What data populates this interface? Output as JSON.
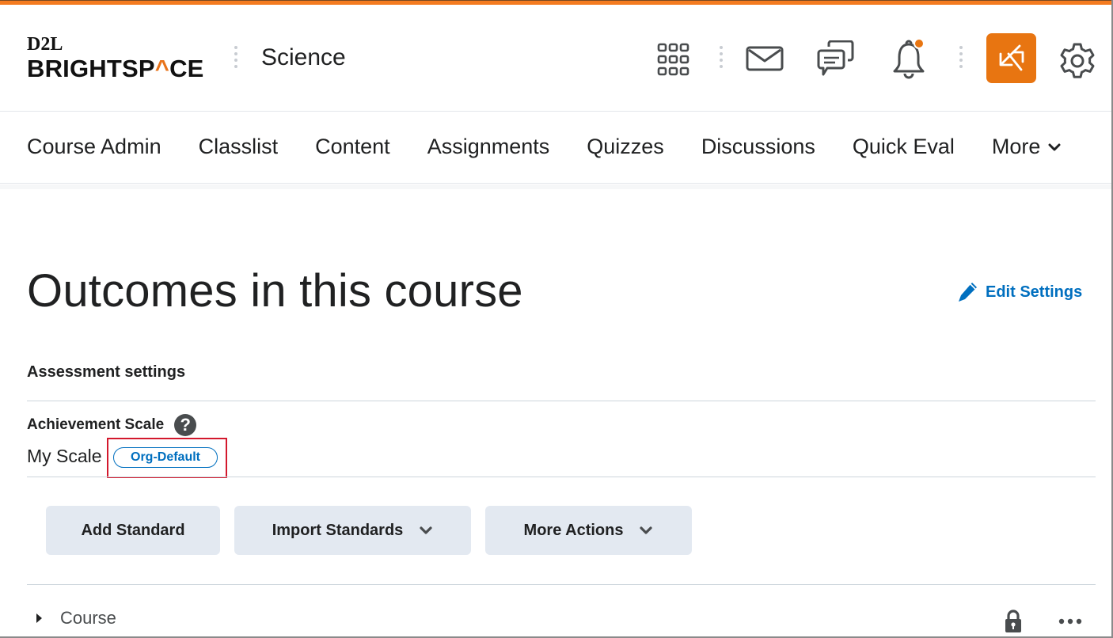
{
  "header": {
    "logo_top": "D2L",
    "logo_bottom_pre": "BRIGHTSP",
    "logo_bottom_accent": "^",
    "logo_bottom_post": "CE",
    "course_name": "Science",
    "icons": [
      "waffle-grid-icon",
      "mail-icon",
      "chat-icon",
      "bell-icon",
      "role-switch-icon",
      "gear-icon"
    ],
    "notification_badge_color": "#e87511"
  },
  "nav": {
    "items": [
      {
        "label": "Course Admin"
      },
      {
        "label": "Classlist"
      },
      {
        "label": "Content"
      },
      {
        "label": "Assignments"
      },
      {
        "label": "Quizzes"
      },
      {
        "label": "Discussions"
      },
      {
        "label": "Quick Eval"
      },
      {
        "label": "More"
      }
    ]
  },
  "main": {
    "title": "Outcomes in this course",
    "edit_settings_label": "Edit Settings",
    "assessment_settings_heading": "Assessment settings",
    "achievement_scale_label": "Achievement Scale",
    "help_glyph": "?",
    "scale_value": "My Scale",
    "scale_badge": "Org-Default",
    "actions": {
      "add_standard": "Add Standard",
      "import_standards": "Import Standards",
      "more_actions": "More Actions"
    },
    "tree": [
      {
        "label": "Course",
        "expanded": false,
        "locked": true
      }
    ]
  },
  "colors": {
    "accent_orange": "#e87511",
    "link_blue": "#006fbf",
    "highlight_red": "#d3182d",
    "button_bg": "#e3e9f1"
  }
}
